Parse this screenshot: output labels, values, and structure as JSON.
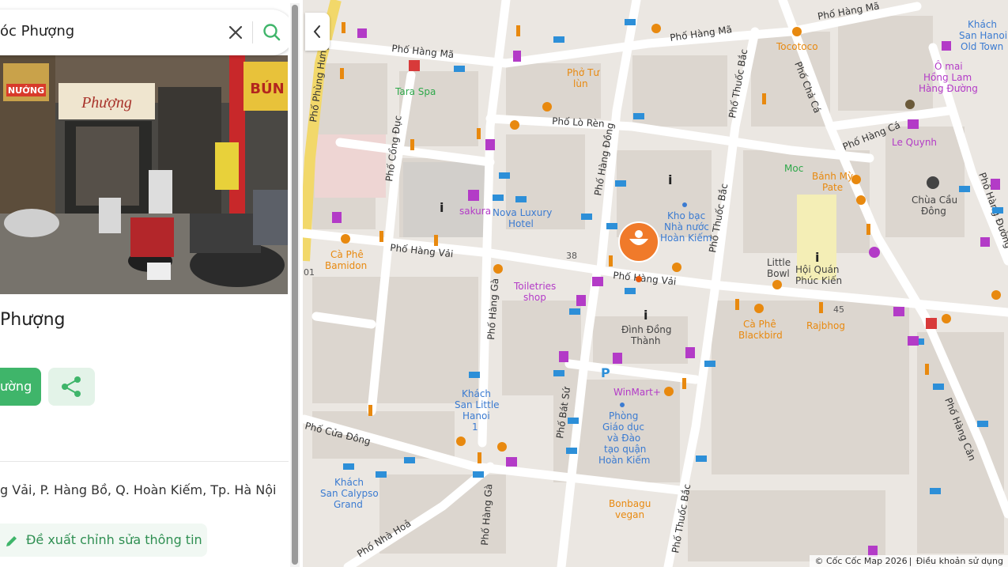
{
  "search": {
    "value": "óc Phượng"
  },
  "photo": {
    "shop_sign": "Phượng",
    "side_sign_left": "NƯỚNG",
    "side_sign_right": "BÚN"
  },
  "place": {
    "title": "Phượng",
    "directions_label": "ường",
    "address": "g Vải, P. Hàng Bồ, Q. Hoàn Kiếm, Tp. Hà Nội",
    "suggest_edit_label": "Đề xuất chỉnh sửa thông tin"
  },
  "map": {
    "attribution": "© Cốc Cốc Map 2026",
    "terms": "Điều khoản sử dụng",
    "street_labels": [
      "Phố Hàng Mã",
      "Phố Hàng Mã",
      "Phố Hàng Mã",
      "Phố Lò Rèn",
      "Phố Hàng Cá",
      "Phố Chả Cá",
      "Phố Thuốc Bắc",
      "Phố Hàng Đồng",
      "Phố Cổng Đục",
      "Phố Phùng Hưng",
      "Phố Hàng Vải",
      "Phố Hàng Vải",
      "Phố Hàng Gà",
      "Phố Bát Sứ",
      "Phố Thuốc Bắc",
      "Phố Hàng Cân",
      "Phố Hàng Đường",
      "Phố Cửa Đông",
      "Phố Nhà Hoả",
      "Phố Hàng Gà",
      "Phố Thuốc Bắc"
    ],
    "place_labels": [
      "Tara Spa",
      "Phở Tư",
      "lùn",
      "Tocotoco",
      "Khách",
      "San Hanoi",
      "Old Town",
      "Ô mai",
      "Hồng Lam",
      "Hàng Đường",
      "Le Quynh",
      "Moc",
      "Bánh Mỳ",
      "Pate",
      "Chùa Cầu",
      "Đông",
      "sakura",
      "Nova Luxury",
      "Hotel",
      "Kho bạc",
      "Nhà nước",
      "Hoàn Kiếm",
      "Little",
      "Bowl",
      "Hội Quán",
      "Phúc Kiến",
      "Cà Phê",
      "Bamidon",
      "Toiletries",
      "shop",
      "Đình Đồng",
      "Thành",
      "Cà Phê",
      "Blackbird",
      "Rajbhog",
      "Khách",
      "San Little",
      "Hanoi",
      "1",
      "WinMart+",
      "Phòng",
      "Giáo dục",
      "và Đào",
      "tạo quận",
      "Hoàn Kiếm",
      "Khách",
      "San Calypso",
      "Grand",
      "Bonbagu",
      "vegan"
    ],
    "house_numbers": [
      "38",
      "45",
      "01"
    ]
  },
  "colors": {
    "accent_green": "#3fb56a",
    "marker_orange": "#f07a2a",
    "map_background": "#ebe7e2",
    "poi_food": "#e8890f",
    "poi_hotel": "#2d8fd8",
    "poi_shop": "#b33bc7",
    "poi_green": "#2ea84a",
    "label_blue": "#3b7bd1"
  },
  "icons": {
    "clear": "close-icon",
    "search": "search-icon",
    "share": "share-icon",
    "edit": "pencil-icon",
    "collapse": "chevron-left-icon",
    "marker": "restaurant-marker-icon"
  }
}
